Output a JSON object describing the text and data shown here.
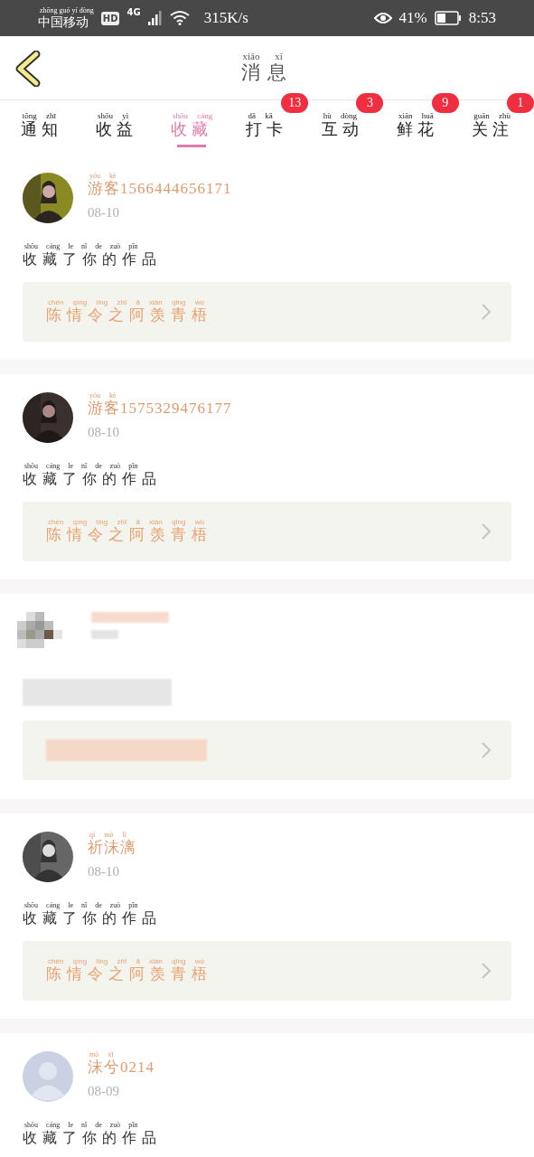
{
  "status_bar": {
    "carrier": "中国移动",
    "carrier_pinyin": "zhōng guó yí dòng",
    "badges": [
      "HD",
      "4G"
    ],
    "speed": "315K/s",
    "battery": "41%",
    "time": "8:53"
  },
  "header": {
    "title": "消息",
    "title_pinyin": "xiāo xī"
  },
  "tabs": [
    {
      "label": "通知",
      "pinyin": "tōng zhī",
      "selected": false
    },
    {
      "label": "收益",
      "pinyin": "shōu yì",
      "selected": false
    },
    {
      "label": "收藏",
      "pinyin": "shōu cáng",
      "selected": true
    },
    {
      "label": "打卡",
      "pinyin": "dǎ kǎ",
      "selected": false,
      "badge": "13"
    },
    {
      "label": "互动",
      "pinyin": "hù dòng",
      "selected": false,
      "badge": "3"
    },
    {
      "label": "鲜花",
      "pinyin": "xiān huā",
      "selected": false,
      "badge": "9"
    },
    {
      "label": "关注",
      "pinyin": "guān zhù",
      "selected": false,
      "badge": "1"
    }
  ],
  "messages": [
    {
      "kind": "normal",
      "name": "游客1566444656171",
      "name_pinyin": "yóu kè",
      "date": "08-10",
      "text": "收藏了你的作品",
      "text_pinyin": "shōu cáng le nǐ de zuò pǐn",
      "work": "陈情令之阿羡青梧",
      "work_pinyin": "chén qíng lìng zhī ā xiàn qīng wú"
    },
    {
      "kind": "normal",
      "name": "游客1575329476177",
      "name_pinyin": "yóu kè",
      "date": "08-10",
      "text": "收藏了你的作品",
      "text_pinyin": "shōu cáng le nǐ de zuò pǐn",
      "work": "陈情令之阿羡青梧",
      "work_pinyin": "chén qíng lìng zhī ā xiàn qīng wú"
    },
    {
      "kind": "redacted"
    },
    {
      "kind": "normal",
      "name": "祈沫漓",
      "name_pinyin": "qí mò lí",
      "date": "08-10",
      "text": "收藏了你的作品",
      "text_pinyin": "shōu cáng le nǐ de zuò pǐn",
      "work": "陈情令之阿羡青梧",
      "work_pinyin": "chén qíng lìng zhī ā xiàn qīng wú"
    },
    {
      "kind": "normal",
      "avatar": {
        "kind": "default"
      },
      "name": "沫兮0214",
      "name_pinyin": "mò xī",
      "date": "08-09",
      "text": "收藏了你的作品",
      "text_pinyin": "shōu cáng le nǐ de zuò pǐn"
    }
  ]
}
